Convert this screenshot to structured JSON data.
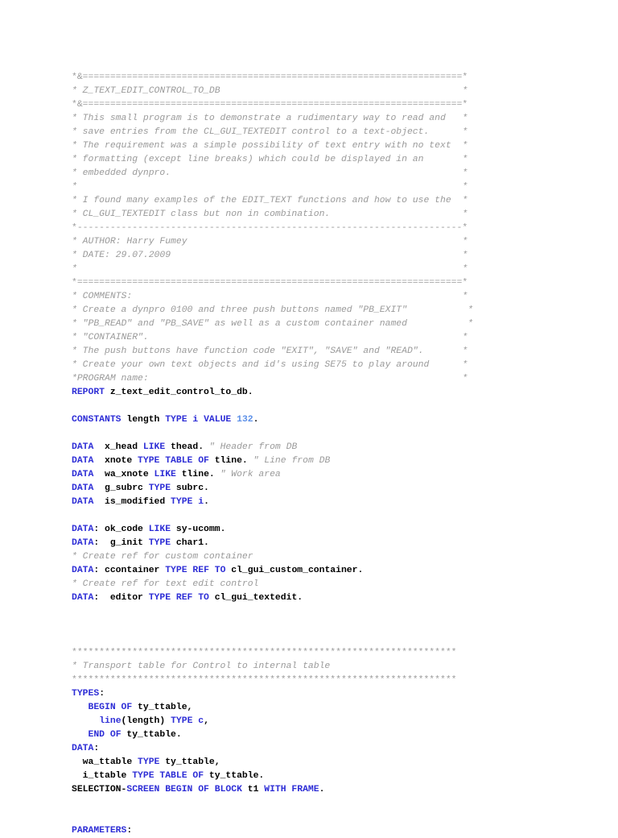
{
  "document": {
    "kind": "source-code-listing",
    "language": "ABAP",
    "program_name": "Z_TEXT_EDIT_CONTROL_TO_DB",
    "author": "Harry Fumey",
    "date": "29.07.2009"
  },
  "colors": {
    "background": "#ffffff",
    "comment": "#9a9a9a",
    "keyword": "#2d2dd6",
    "identifier": "#000000",
    "literal": "#5b8fe8"
  },
  "code": {
    "lines": [
      {
        "type": "rule",
        "text": "*&=====================================================================*"
      },
      {
        "type": "comment",
        "text": "* Z_TEXT_EDIT_CONTROL_TO_DB                                            *"
      },
      {
        "type": "rule",
        "text": "*&=====================================================================*"
      },
      {
        "type": "comment",
        "text": "* This small program is to demonstrate a rudimentary way to read and   *"
      },
      {
        "type": "comment",
        "text": "* save entries from the CL_GUI_TEXTEDIT control to a text-object.      *"
      },
      {
        "type": "comment",
        "text": "* The requirement was a simple possibility of text entry with no text  *"
      },
      {
        "type": "comment",
        "text": "* formatting (except line breaks) which could be displayed in an       *"
      },
      {
        "type": "comment",
        "text": "* embedded dynpro.                                                     *"
      },
      {
        "type": "comment",
        "text": "*                                                                      *"
      },
      {
        "type": "comment",
        "text": "* I found many examples of the EDIT_TEXT functions and how to use the  *"
      },
      {
        "type": "comment",
        "text": "* CL_GUI_TEXTEDIT class but non in combination.                        *"
      },
      {
        "type": "rule",
        "text": "*----------------------------------------------------------------------*"
      },
      {
        "type": "comment",
        "text": "* AUTHOR: Harry Fumey                                                  *"
      },
      {
        "type": "comment",
        "text": "* DATE: 29.07.2009                                                     *"
      },
      {
        "type": "comment",
        "text": "*                                                                      *"
      },
      {
        "type": "rule",
        "text": "*======================================================================*"
      },
      {
        "type": "comment",
        "text": "* COMMENTS:                                                            *"
      },
      {
        "type": "comment",
        "text": "* Create a dynpro 0100 and three push buttons named \"PB_EXIT\"           *"
      },
      {
        "type": "comment",
        "text": "* \"PB_READ\" and \"PB_SAVE\" as well as a custom container named           *"
      },
      {
        "type": "comment",
        "text": "* \"CONTAINER\".                                                         *"
      },
      {
        "type": "comment",
        "text": "* The push buttons have function code \"EXIT\", \"SAVE\" and \"READ\".       *"
      },
      {
        "type": "comment",
        "text": "* Create your own text objects and id's using SE75 to play around      *"
      },
      {
        "type": "comment",
        "text": "*PROGRAM name:                                                         *"
      },
      {
        "type": "code",
        "tokens": [
          {
            "c": "kw",
            "t": "REPORT"
          },
          {
            "c": "id",
            "t": " z_text_edit_control_to_db."
          }
        ]
      },
      {
        "type": "blank"
      },
      {
        "type": "code",
        "tokens": [
          {
            "c": "kw",
            "t": "CONSTANTS"
          },
          {
            "c": "id",
            "t": " length "
          },
          {
            "c": "kw",
            "t": "TYPE"
          },
          {
            "c": "id",
            "t": " "
          },
          {
            "c": "kw",
            "t": "i"
          },
          {
            "c": "id",
            "t": " "
          },
          {
            "c": "kw",
            "t": "VALUE"
          },
          {
            "c": "id",
            "t": " "
          },
          {
            "c": "num",
            "t": "132"
          },
          {
            "c": "id",
            "t": "."
          }
        ]
      },
      {
        "type": "blank"
      },
      {
        "type": "code",
        "tokens": [
          {
            "c": "kw",
            "t": "DATA"
          },
          {
            "c": "id",
            "t": "  x_head "
          },
          {
            "c": "kw",
            "t": "LIKE"
          },
          {
            "c": "id",
            "t": " thead. "
          },
          {
            "c": "cmt",
            "t": "\" Header from DB"
          }
        ]
      },
      {
        "type": "code",
        "tokens": [
          {
            "c": "kw",
            "t": "DATA"
          },
          {
            "c": "id",
            "t": "  xnote "
          },
          {
            "c": "kw",
            "t": "TYPE TABLE OF"
          },
          {
            "c": "id",
            "t": " tline. "
          },
          {
            "c": "cmt",
            "t": "\" Line from DB"
          }
        ]
      },
      {
        "type": "code",
        "tokens": [
          {
            "c": "kw",
            "t": "DATA"
          },
          {
            "c": "id",
            "t": "  wa_xnote "
          },
          {
            "c": "kw",
            "t": "LIKE"
          },
          {
            "c": "id",
            "t": " tline. "
          },
          {
            "c": "cmt",
            "t": "\" Work area"
          }
        ]
      },
      {
        "type": "code",
        "tokens": [
          {
            "c": "kw",
            "t": "DATA"
          },
          {
            "c": "id",
            "t": "  g_subrc "
          },
          {
            "c": "kw",
            "t": "TYPE"
          },
          {
            "c": "id",
            "t": " subrc."
          }
        ]
      },
      {
        "type": "code",
        "tokens": [
          {
            "c": "kw",
            "t": "DATA"
          },
          {
            "c": "id",
            "t": "  is_modified "
          },
          {
            "c": "kw",
            "t": "TYPE"
          },
          {
            "c": "id",
            "t": " "
          },
          {
            "c": "kw",
            "t": "i"
          },
          {
            "c": "id",
            "t": "."
          }
        ]
      },
      {
        "type": "blank"
      },
      {
        "type": "code",
        "tokens": [
          {
            "c": "kw",
            "t": "DATA"
          },
          {
            "c": "id",
            "t": ": ok_code "
          },
          {
            "c": "kw",
            "t": "LIKE"
          },
          {
            "c": "id",
            "t": " sy-ucomm."
          }
        ]
      },
      {
        "type": "code",
        "tokens": [
          {
            "c": "kw",
            "t": "DATA"
          },
          {
            "c": "id",
            "t": ":  g_init "
          },
          {
            "c": "kw",
            "t": "TYPE"
          },
          {
            "c": "id",
            "t": " char1."
          }
        ]
      },
      {
        "type": "comment",
        "text": "* Create ref for custom container"
      },
      {
        "type": "code",
        "tokens": [
          {
            "c": "kw",
            "t": "DATA"
          },
          {
            "c": "id",
            "t": ": ccontainer "
          },
          {
            "c": "kw",
            "t": "TYPE REF TO"
          },
          {
            "c": "id",
            "t": " cl_gui_custom_container."
          }
        ]
      },
      {
        "type": "comment",
        "text": "* Create ref for text edit control"
      },
      {
        "type": "code",
        "tokens": [
          {
            "c": "kw",
            "t": "DATA"
          },
          {
            "c": "id",
            "t": ":  editor "
          },
          {
            "c": "kw",
            "t": "TYPE REF TO"
          },
          {
            "c": "id",
            "t": " cl_gui_textedit."
          }
        ]
      },
      {
        "type": "blank"
      },
      {
        "type": "blank"
      },
      {
        "type": "blank"
      },
      {
        "type": "rule",
        "text": "**********************************************************************"
      },
      {
        "type": "comment",
        "text": "* Transport table for Control to internal table"
      },
      {
        "type": "rule",
        "text": "**********************************************************************"
      },
      {
        "type": "code",
        "tokens": [
          {
            "c": "kw",
            "t": "TYPES"
          },
          {
            "c": "id",
            "t": ":"
          }
        ]
      },
      {
        "type": "code",
        "tokens": [
          {
            "c": "id",
            "t": "   "
          },
          {
            "c": "kw",
            "t": "BEGIN OF"
          },
          {
            "c": "id",
            "t": " ty_ttable,"
          }
        ]
      },
      {
        "type": "code",
        "tokens": [
          {
            "c": "id",
            "t": "     "
          },
          {
            "c": "kw",
            "t": "line"
          },
          {
            "c": "id",
            "t": "(length) "
          },
          {
            "c": "kw",
            "t": "TYPE c"
          },
          {
            "c": "id",
            "t": ","
          }
        ]
      },
      {
        "type": "code",
        "tokens": [
          {
            "c": "id",
            "t": "   "
          },
          {
            "c": "kw",
            "t": "END OF"
          },
          {
            "c": "id",
            "t": " ty_ttable."
          }
        ]
      },
      {
        "type": "code",
        "tokens": [
          {
            "c": "kw",
            "t": "DATA"
          },
          {
            "c": "id",
            "t": ":"
          }
        ]
      },
      {
        "type": "code",
        "tokens": [
          {
            "c": "id",
            "t": "  wa_ttable "
          },
          {
            "c": "kw",
            "t": "TYPE"
          },
          {
            "c": "id",
            "t": " ty_ttable,"
          }
        ]
      },
      {
        "type": "code",
        "tokens": [
          {
            "c": "id",
            "t": "  i_ttable "
          },
          {
            "c": "kw",
            "t": "TYPE TABLE OF"
          },
          {
            "c": "id",
            "t": " ty_ttable."
          }
        ]
      },
      {
        "type": "code",
        "tokens": [
          {
            "c": "id",
            "t": "SELECTION-"
          },
          {
            "c": "kw",
            "t": "SCREEN BEGIN OF BLOCK"
          },
          {
            "c": "id",
            "t": " t1 "
          },
          {
            "c": "kw",
            "t": "WITH FRAME"
          },
          {
            "c": "id",
            "t": "."
          }
        ]
      },
      {
        "type": "blank"
      },
      {
        "type": "blank"
      },
      {
        "type": "code",
        "tokens": [
          {
            "c": "kw",
            "t": "PARAMETERS"
          },
          {
            "c": "id",
            "t": ":"
          }
        ]
      }
    ]
  }
}
